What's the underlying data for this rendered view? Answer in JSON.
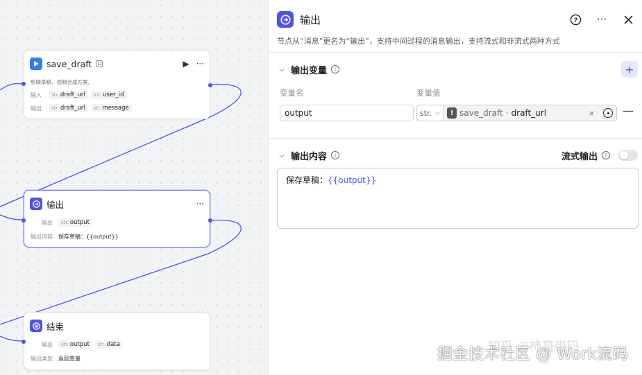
{
  "canvas": {
    "nodes": {
      "save_draft": {
        "title": "save_draft",
        "desc": "剪映草稿，视频合成方案。",
        "in_label": "输入",
        "out_label": "输出",
        "inputs": [
          {
            "type": "str.",
            "name": "draft_url"
          },
          {
            "type": "int.",
            "name": "user_id"
          }
        ],
        "outputs": [
          {
            "type": "str.",
            "name": "draft_url"
          },
          {
            "type": "str.",
            "name": "message"
          }
        ]
      },
      "output": {
        "title": "输出",
        "out_label": "输出",
        "content_label": "输出内容",
        "outputs": [
          {
            "type": "str.",
            "name": "output"
          }
        ],
        "content": "保存草稿：{{output}}"
      },
      "end": {
        "title": "结束",
        "out_label": "输出",
        "type_label": "输出类型",
        "outputs": [
          {
            "type": "str.",
            "name": "output"
          },
          {
            "type": "str.",
            "name": "data"
          }
        ],
        "type_value": "返回变量"
      }
    }
  },
  "panel": {
    "title": "输出",
    "description": "节点从“消息”更名为“输出”，支持中间过程的消息输出，支持流式和非流式两种方式",
    "output_vars": {
      "title": "输出变量",
      "col_name": "变量名",
      "col_value": "变量值",
      "row": {
        "name": "output",
        "type": "str.",
        "ref_node": "save_draft",
        "ref_sep": "·",
        "ref_var": "draft_url"
      }
    },
    "output_content": {
      "title": "输出内容",
      "stream_label": "流式输出",
      "stream_on": false,
      "text_prefix": "保存草稿：",
      "text_var": "{{output}}"
    }
  },
  "watermark": {
    "main": "掘金技术社区 @ Work流码",
    "faint": "知乎 @柿哥带码"
  },
  "colors": {
    "accent": "#4d53e8",
    "play_icon": "#2f7cf6"
  }
}
